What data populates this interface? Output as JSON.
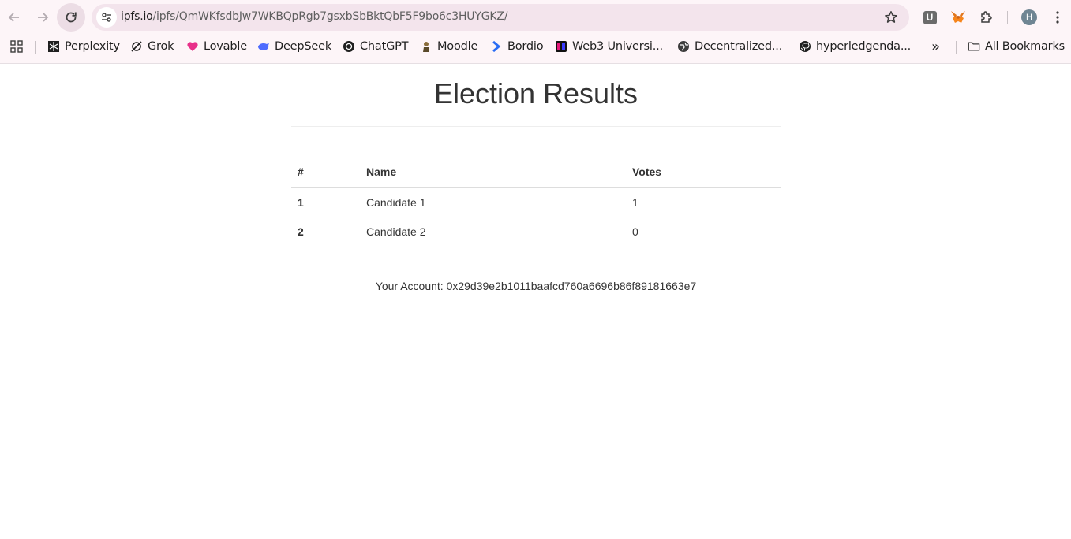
{
  "browser": {
    "url_host": "ipfs.io",
    "url_path": "/ipfs/QmWKfsdbJw7WKBQpRgb7gsxbSbBktQbF5F9bo6c3HUYGKZ/",
    "profile_initial": "H",
    "extension_badge": "U",
    "bookmarks": [
      {
        "label": "Perplexity"
      },
      {
        "label": "Grok"
      },
      {
        "label": "Lovable"
      },
      {
        "label": "DeepSeek"
      },
      {
        "label": "ChatGPT"
      },
      {
        "label": "Moodle"
      },
      {
        "label": "Bordio"
      },
      {
        "label": "Web3 Universi..."
      },
      {
        "label": "Decentralized..."
      },
      {
        "label": "hyperledgenda..."
      }
    ],
    "overflow_label": "»",
    "all_bookmarks_label": "All Bookmarks"
  },
  "page": {
    "title": "Election Results",
    "table": {
      "headers": [
        "#",
        "Name",
        "Votes"
      ],
      "rows": [
        {
          "rank": "1",
          "name": "Candidate 1",
          "votes": "1"
        },
        {
          "rank": "2",
          "name": "Candidate 2",
          "votes": "0"
        }
      ]
    },
    "account_text": "Your Account: 0x29d39e2b1011baafcd760a6696b86f89181663e7"
  },
  "colors": {
    "chrome_bg": "#fdf5f8",
    "omnibox_bg": "#f3e4ec",
    "text": "#333333",
    "table_border": "#dddddd"
  }
}
